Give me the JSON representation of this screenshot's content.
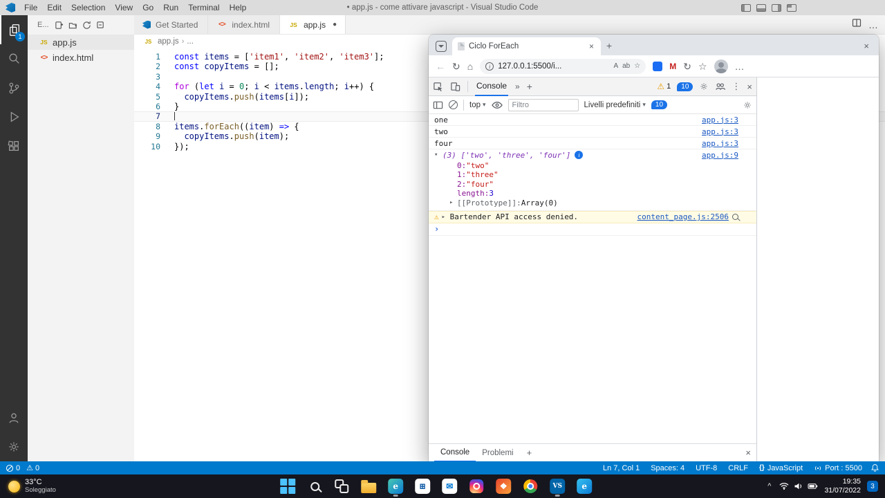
{
  "colors": {
    "accent": "#007acc",
    "devtools_accent": "#1a73e8",
    "warning_bg": "#fffbe5",
    "link": "#1a58c2"
  },
  "icons": {
    "close": "×",
    "chevron_down": "▾",
    "chevron_right": "▸",
    "chevron_up": "^",
    "breadcrumb_sep": "›",
    "double_chevron": "»",
    "plus": "+",
    "back_arrow": "←",
    "refresh": "↻",
    "home": "⌂",
    "warning": "⚠",
    "kebab": "⋮",
    "ellipsis": "…",
    "star": "☆",
    "read_aloud": "A",
    "translate": "ab",
    "ext_m": "M",
    "js_badge": "JS",
    "html_badge": "<>",
    "braces": "{}",
    "dirty_dot": "●",
    "info": "i",
    "prompt": "›"
  },
  "vscode": {
    "titlebar": {
      "menus": [
        "File",
        "Edit",
        "Selection",
        "View",
        "Go",
        "Run",
        "Terminal",
        "Help"
      ],
      "title": "• app.js - come attivare javascript - Visual Studio Code"
    },
    "activity_badge": "1",
    "explorer": {
      "header": "E...",
      "files": [
        {
          "name": "app.js",
          "icon": "js",
          "selected": true
        },
        {
          "name": "index.html",
          "icon": "html",
          "selected": false
        }
      ]
    },
    "tabs": [
      {
        "label": "Get Started",
        "icon": "vscode",
        "active": false,
        "dirty": false
      },
      {
        "label": "index.html",
        "icon": "html",
        "active": false,
        "dirty": false
      },
      {
        "label": "app.js",
        "icon": "js",
        "active": true,
        "dirty": true
      }
    ],
    "breadcrumb": {
      "file": "app.js",
      "rest": "..."
    },
    "code": {
      "current_line": 7,
      "lines": [
        {
          "num": 1,
          "tokens": [
            [
              "k",
              "const"
            ],
            [
              "p",
              " "
            ],
            [
              "v",
              "items"
            ],
            [
              "p",
              " = ["
            ],
            [
              "s",
              "'item1'"
            ],
            [
              "p",
              ", "
            ],
            [
              "s",
              "'item2'"
            ],
            [
              "p",
              ", "
            ],
            [
              "s",
              "'item3'"
            ],
            [
              "p",
              "];"
            ]
          ]
        },
        {
          "num": 2,
          "tokens": [
            [
              "k",
              "const"
            ],
            [
              "p",
              " "
            ],
            [
              "v",
              "copyItems"
            ],
            [
              "p",
              " = [];"
            ]
          ]
        },
        {
          "num": 3,
          "tokens": []
        },
        {
          "num": 4,
          "tokens": [
            [
              "c",
              "for"
            ],
            [
              "p",
              " ("
            ],
            [
              "k",
              "let"
            ],
            [
              "p",
              " "
            ],
            [
              "v",
              "i"
            ],
            [
              "p",
              " = "
            ],
            [
              "n",
              "0"
            ],
            [
              "p",
              "; "
            ],
            [
              "v",
              "i"
            ],
            [
              "p",
              " < "
            ],
            [
              "v",
              "items"
            ],
            [
              "p",
              "."
            ],
            [
              "v",
              "length"
            ],
            [
              "p",
              "; "
            ],
            [
              "v",
              "i"
            ],
            [
              "p",
              "++) {"
            ]
          ]
        },
        {
          "num": 5,
          "tokens": [
            [
              "p",
              "  "
            ],
            [
              "v",
              "copyItems"
            ],
            [
              "p",
              "."
            ],
            [
              "f",
              "push"
            ],
            [
              "p",
              "("
            ],
            [
              "v",
              "items"
            ],
            [
              "p",
              "["
            ],
            [
              "v",
              "i"
            ],
            [
              "p",
              "]);"
            ]
          ]
        },
        {
          "num": 6,
          "tokens": [
            [
              "p",
              "}"
            ]
          ]
        },
        {
          "num": 7,
          "tokens": [],
          "cursor": true
        },
        {
          "num": 8,
          "tokens": [
            [
              "v",
              "items"
            ],
            [
              "p",
              "."
            ],
            [
              "f",
              "forEach"
            ],
            [
              "p",
              "(("
            ],
            [
              "v",
              "item"
            ],
            [
              "p",
              ") "
            ],
            [
              "k",
              "=>"
            ],
            [
              "p",
              " {"
            ]
          ]
        },
        {
          "num": 9,
          "tokens": [
            [
              "p",
              "  "
            ],
            [
              "v",
              "copyItems"
            ],
            [
              "p",
              "."
            ],
            [
              "f",
              "push"
            ],
            [
              "p",
              "("
            ],
            [
              "v",
              "item"
            ],
            [
              "p",
              ");"
            ]
          ]
        },
        {
          "num": 10,
          "tokens": [
            [
              "p",
              "});"
            ]
          ]
        }
      ]
    },
    "statusbar": {
      "errors": "0",
      "warnings": "0",
      "items": [
        "Ln 7, Col 1",
        "Spaces: 4",
        "UTF-8",
        "CRLF",
        "JavaScript",
        "Port : 5500"
      ]
    }
  },
  "browser": {
    "tab_title": "Ciclo ForEach",
    "url": "127.0.0.1:5500/i...",
    "devtools": {
      "tab": "Console",
      "warn_count": "1",
      "msg_count": "10",
      "toolbar": {
        "context": "top",
        "filter_placeholder": "Filtro",
        "levels": "Livelli predefiniti",
        "badge": "10"
      },
      "console": {
        "rows": [
          {
            "kind": "log",
            "text": "one",
            "link": "app.js:3"
          },
          {
            "kind": "log",
            "text": "two",
            "link": "app.js:3"
          },
          {
            "kind": "log",
            "text": "four",
            "link": "app.js:3"
          },
          {
            "kind": "array",
            "preview": "(3) ['two', 'three', 'four']",
            "link": "app.js:9",
            "children": [
              {
                "key": "0",
                "val": "\"two\"",
                "vtype": "str"
              },
              {
                "key": "1",
                "val": "\"three\"",
                "vtype": "str"
              },
              {
                "key": "2",
                "val": "\"four\"",
                "vtype": "str"
              },
              {
                "key": "length",
                "val": "3",
                "vtype": "num"
              },
              {
                "key": "[[Prototype]]",
                "val": "Array(0)",
                "vtype": "proto",
                "expand": true
              }
            ]
          },
          {
            "kind": "warning",
            "text": "Bartender API access denied.",
            "link": "content_page.js:2506"
          }
        ],
        "prompt": "›"
      },
      "drawer": {
        "tabs": [
          {
            "label": "Console",
            "active": true
          },
          {
            "label": "Problemi",
            "active": false
          }
        ]
      }
    }
  },
  "taskbar": {
    "weather": {
      "temp": "33°C",
      "condition": "Soleggiato"
    },
    "apps": [
      {
        "name": "start",
        "shape": "start"
      },
      {
        "name": "search",
        "shape": "search"
      },
      {
        "name": "task-view",
        "shape": "taskview"
      },
      {
        "name": "file-explorer",
        "shape": "folder"
      },
      {
        "name": "edge",
        "shape": "chip",
        "glyph": "e",
        "bg": "linear-gradient(135deg,#49c9b1,#0b7bd4)",
        "fg": "#fff",
        "running": true
      },
      {
        "name": "store",
        "shape": "chip",
        "glyph": "⊞",
        "bg": "#ffffff",
        "fg": "#0c59a4"
      },
      {
        "name": "mail",
        "shape": "chip",
        "glyph": "✉",
        "bg": "#ffffff",
        "fg": "#0078d4"
      },
      {
        "name": "instagram",
        "shape": "instagram"
      },
      {
        "name": "photos",
        "shape": "chip",
        "glyph": "❖",
        "bg": "linear-gradient(135deg,#e8452c,#f9a13b)",
        "fg": "#fff"
      },
      {
        "name": "chrome",
        "shape": "chrome"
      },
      {
        "name": "vscode",
        "shape": "chip",
        "glyph": "VS",
        "bg": "#0065a9",
        "fg": "#fff",
        "running": true
      },
      {
        "name": "edge-beta",
        "shape": "chip",
        "glyph": "e",
        "bg": "linear-gradient(135deg,#35c1f1,#0b7bd4)",
        "fg": "#fff"
      }
    ],
    "clock": {
      "time": "19:35",
      "date": "31/07/2022"
    },
    "notification_count": "3"
  }
}
